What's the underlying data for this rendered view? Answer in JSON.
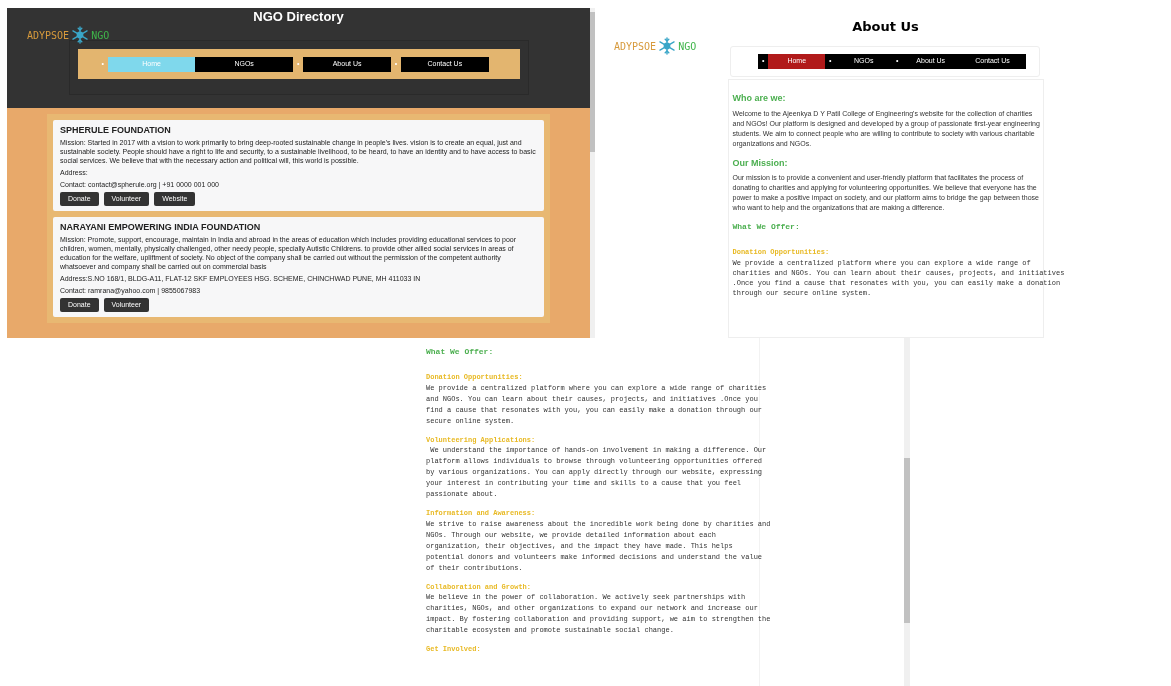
{
  "panels": [
    {
      "kind": "directory",
      "title": "NGO Directory",
      "logo": {
        "left": "ADYPSOE",
        "right": "NGO"
      },
      "nav": [
        {
          "label": "Home",
          "bullet": "•",
          "selected": true
        },
        {
          "label": "NGOs",
          "selected": false
        },
        {
          "label": "About Us",
          "bullet": "•",
          "selected": false
        },
        {
          "label": "Contact Us",
          "bullet": "•",
          "selected": false
        }
      ],
      "ngos": [
        {
          "name": "SPHERULE FOUNDATION",
          "mission": "Mission: Started in 2017 with a vision to work primarily to bring deep-rooted sustainable change in people's lives. vision is to create an equal, just and sustainable society. People should have a right to life and security, to a sustainable livelihood, to be heard, to have an identity and to have access to basic social services. We believe that with the necessary action and political will, this world is possible.",
          "address": "Address:",
          "contact": "Contact: contact@spherule.org | +91 0000 001 000",
          "buttons": [
            "Donate",
            "Volunteer",
            "Website"
          ]
        },
        {
          "name": "NARAYANI EMPOWERING INDIA FOUNDATION",
          "mission": "Mission: Promote, support, encourage, maintain in India and abroad in the areas of education which includes providing educational services to poor children, women, mentally, physically challenged, other needy people, specially Autistic Childrens. to provide other allied social services in areas of education for the welfare, upliftment of society. No object of the company shall be carried out without the permission of the competent authority whatsoever and company shall be carried out on commercial basis",
          "address": "Address:S.NO 168/1, BLDG-A11, FLAT-12 SKF EMPLOYEES HSG. SCHEME, CHINCHWAD PUNE, MH 411033 IN",
          "contact": "Contact: ramrana@yahoo.com | 9855067983",
          "buttons": [
            "Donate",
            "Volunteer"
          ]
        }
      ]
    },
    {
      "kind": "about",
      "title": "About Us",
      "logo": {
        "left": "ADYPSOE",
        "right": "NGO"
      },
      "nav": [
        {
          "label": "Home",
          "bullet": "•",
          "selected": true
        },
        {
          "label": "NGOs",
          "bullet": "•",
          "selected": false
        },
        {
          "label": "About Us",
          "bullet": "•",
          "selected": false
        },
        {
          "label": "Contact Us",
          "selected": false
        }
      ],
      "sections": [
        {
          "kind": "heading",
          "text": "Who are we:"
        },
        {
          "kind": "paragraph",
          "text": "Welcome to the Ajeenkya D Y Patil College of Engineering's website for the collection of charities and NGOs! Our platform is designed and developed by a group of passionate first-year engineering students. We aim to connect people who are willing to contribute to society with various charitable organizations and NGOs."
        },
        {
          "kind": "heading",
          "text": "Our Mission:"
        },
        {
          "kind": "paragraph",
          "text": "Our mission is to provide a convenient and user-friendly platform that facilitates the process of donating to charities and applying for volunteering opportunities. We believe that everyone has the power to make a positive impact on society, and our platform aims to bridge the gap between those who want to help and the organizations that are making a difference."
        },
        {
          "kind": "mono_heading",
          "text": "What We Offer:"
        },
        {
          "kind": "subheading",
          "text": "Donation Opportunities:"
        },
        {
          "kind": "mono_paragraph",
          "text": "We provide a centralized platform where you can explore a wide range of charities and NGOs. You can learn about their causes, projects, and initiatives .Once you find a cause that resonates with you, you can easily make a donation through our secure online system."
        }
      ]
    },
    {
      "kind": "offer",
      "sections": [
        {
          "kind": "mono_heading",
          "text": "What We Offer:"
        },
        {
          "kind": "subheading",
          "text": "Donation Opportunities:"
        },
        {
          "kind": "mono_paragraph",
          "text": "We provide a centralized platform where you can explore a wide range of charities and NGOs. You can learn about their causes, projects, and initiatives .Once you find a cause that resonates with you, you can easily make a donation through our secure online system."
        },
        {
          "kind": "subheading",
          "text": "Volunteering Applications:"
        },
        {
          "kind": "mono_paragraph",
          "text": " We understand the importance of hands-on involvement in making a difference. Our platform allows individuals to browse through volunteering opportunities offered by various organizations. You can apply directly through our website, expressing your interest in contributing your time and skills to a cause that you feel passionate about."
        },
        {
          "kind": "subheading",
          "text": "Information and Awareness:"
        },
        {
          "kind": "mono_paragraph",
          "text": "We strive to raise awareness about the incredible work being done by charities and NGOs. Through our website, we provide detailed information about each organization, their objectives, and the impact they have made. This helps potential donors and volunteers make informed decisions and understand the value of their contributions."
        },
        {
          "kind": "subheading",
          "text": "Collaboration and Growth:"
        },
        {
          "kind": "mono_paragraph",
          "text": "We believe in the power of collaboration. We actively seek partnerships with charities, NGOs, and other organizations to expand our network and increase our impact. By fostering collaboration and providing support, we aim to strengthen the charitable ecosystem and promote sustainable social change."
        },
        {
          "kind": "subheading",
          "text": "Get Involved:"
        }
      ]
    }
  ]
}
